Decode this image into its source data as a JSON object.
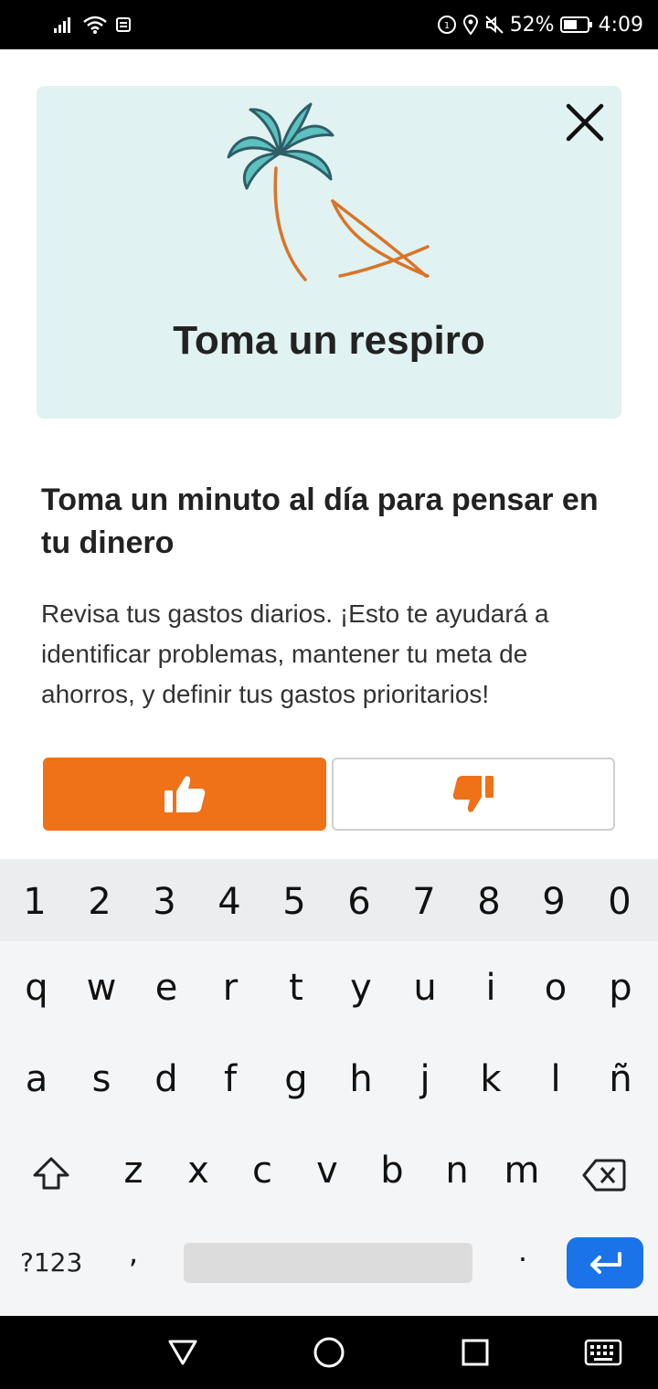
{
  "status_bar": {
    "battery": "52%",
    "time": "4:09"
  },
  "card": {
    "title": "Toma un respiro",
    "background": "#e0f2f1"
  },
  "content": {
    "headline": "Toma un minuto al día para pensar en tu dinero",
    "body": "Revisa tus gastos diarios. ¡Esto te ayudará a identificar problemas, mantener tu meta de ahorros, y definir tus gastos prioritarios!"
  },
  "feedback": {
    "accent": "#ef7218",
    "like_icon": "thumbs-up-icon",
    "dislike_icon": "thumbs-down-icon"
  },
  "keyboard": {
    "numbers": [
      "1",
      "2",
      "3",
      "4",
      "5",
      "6",
      "7",
      "8",
      "9",
      "0"
    ],
    "row1": [
      "q",
      "w",
      "e",
      "r",
      "t",
      "y",
      "u",
      "i",
      "o",
      "p"
    ],
    "row2": [
      "a",
      "s",
      "d",
      "f",
      "g",
      "h",
      "j",
      "k",
      "l",
      "ñ"
    ],
    "row3": [
      "z",
      "x",
      "c",
      "v",
      "b",
      "n",
      "m"
    ],
    "symbols_label": "?123",
    "comma": ",",
    "period": ".",
    "enter_color": "#1a73e8"
  }
}
